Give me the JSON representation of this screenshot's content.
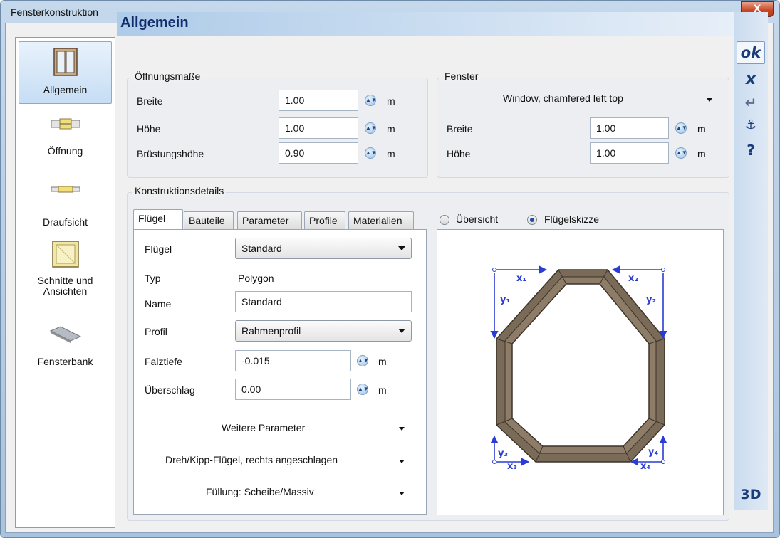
{
  "window": {
    "title": "Fensterkonstruktion",
    "close_label": "X"
  },
  "sidebar": {
    "items": [
      {
        "label": "Allgemein",
        "icon": "window-icon",
        "active": true
      },
      {
        "label": "Öffnung",
        "icon": "wall-opening-icon"
      },
      {
        "label": "Draufsicht",
        "icon": "top-view-icon"
      },
      {
        "label_line1": "Schnitte und",
        "label_line2": "Ansichten",
        "icon": "sections-icon"
      },
      {
        "label": "Fensterbank",
        "icon": "window-sill-icon"
      }
    ]
  },
  "header": {
    "title": "Allgemein"
  },
  "toolbar": {
    "ok": "ok",
    "cancel": "x",
    "enter": "↵",
    "anchor": "⚓",
    "help": "?",
    "view3d": "3D"
  },
  "oeffnungsmasse": {
    "legend": "Öffnungsmaße",
    "fields": [
      {
        "label": "Breite",
        "value": "1.00",
        "unit": "m"
      },
      {
        "label": "Höhe",
        "value": "1.00",
        "unit": "m"
      },
      {
        "label": "Brüstungshöhe",
        "value": "0.90",
        "unit": "m"
      }
    ]
  },
  "fenster": {
    "legend": "Fenster",
    "type": "Window, chamfered left top",
    "fields": [
      {
        "label": "Breite",
        "value": "1.00",
        "unit": "m"
      },
      {
        "label": "Höhe",
        "value": "1.00",
        "unit": "m"
      }
    ]
  },
  "konstruktion": {
    "legend": "Konstruktionsdetails",
    "tabs": [
      "Flügel",
      "Bauteile",
      "Parameter",
      "Profile",
      "Materialien"
    ],
    "fluegel": {
      "fluegel_label": "Flügel",
      "fluegel_value": "Standard",
      "typ_label": "Typ",
      "typ_value": "Polygon",
      "name_label": "Name",
      "name_value": "Standard",
      "profil_label": "Profil",
      "profil_value": "Rahmenprofil",
      "falztiefe_label": "Falztiefe",
      "falztiefe_value": "-0.015",
      "falztiefe_unit": "m",
      "ueberschlag_label": "Überschlag",
      "ueberschlag_value": "0.00",
      "ueberschlag_unit": "m",
      "weitere": "Weitere Parameter",
      "dreh": "Dreh/Kipp-Flügel, rechts angeschlagen",
      "fuellung": "Füllung: Scheibe/Massiv"
    },
    "view": {
      "options": [
        "Übersicht",
        "Flügelskizze"
      ],
      "selected": "Flügelskizze"
    }
  },
  "sketch": {
    "labels": {
      "x1": "x₁",
      "x2": "x₂",
      "x3": "x₃",
      "x4": "x₄",
      "y1": "y₁",
      "y2": "y₂",
      "y3": "y₃",
      "y4": "y₄"
    },
    "frame_color": "#7a6a58",
    "dim_color": "#2a3bd6"
  }
}
